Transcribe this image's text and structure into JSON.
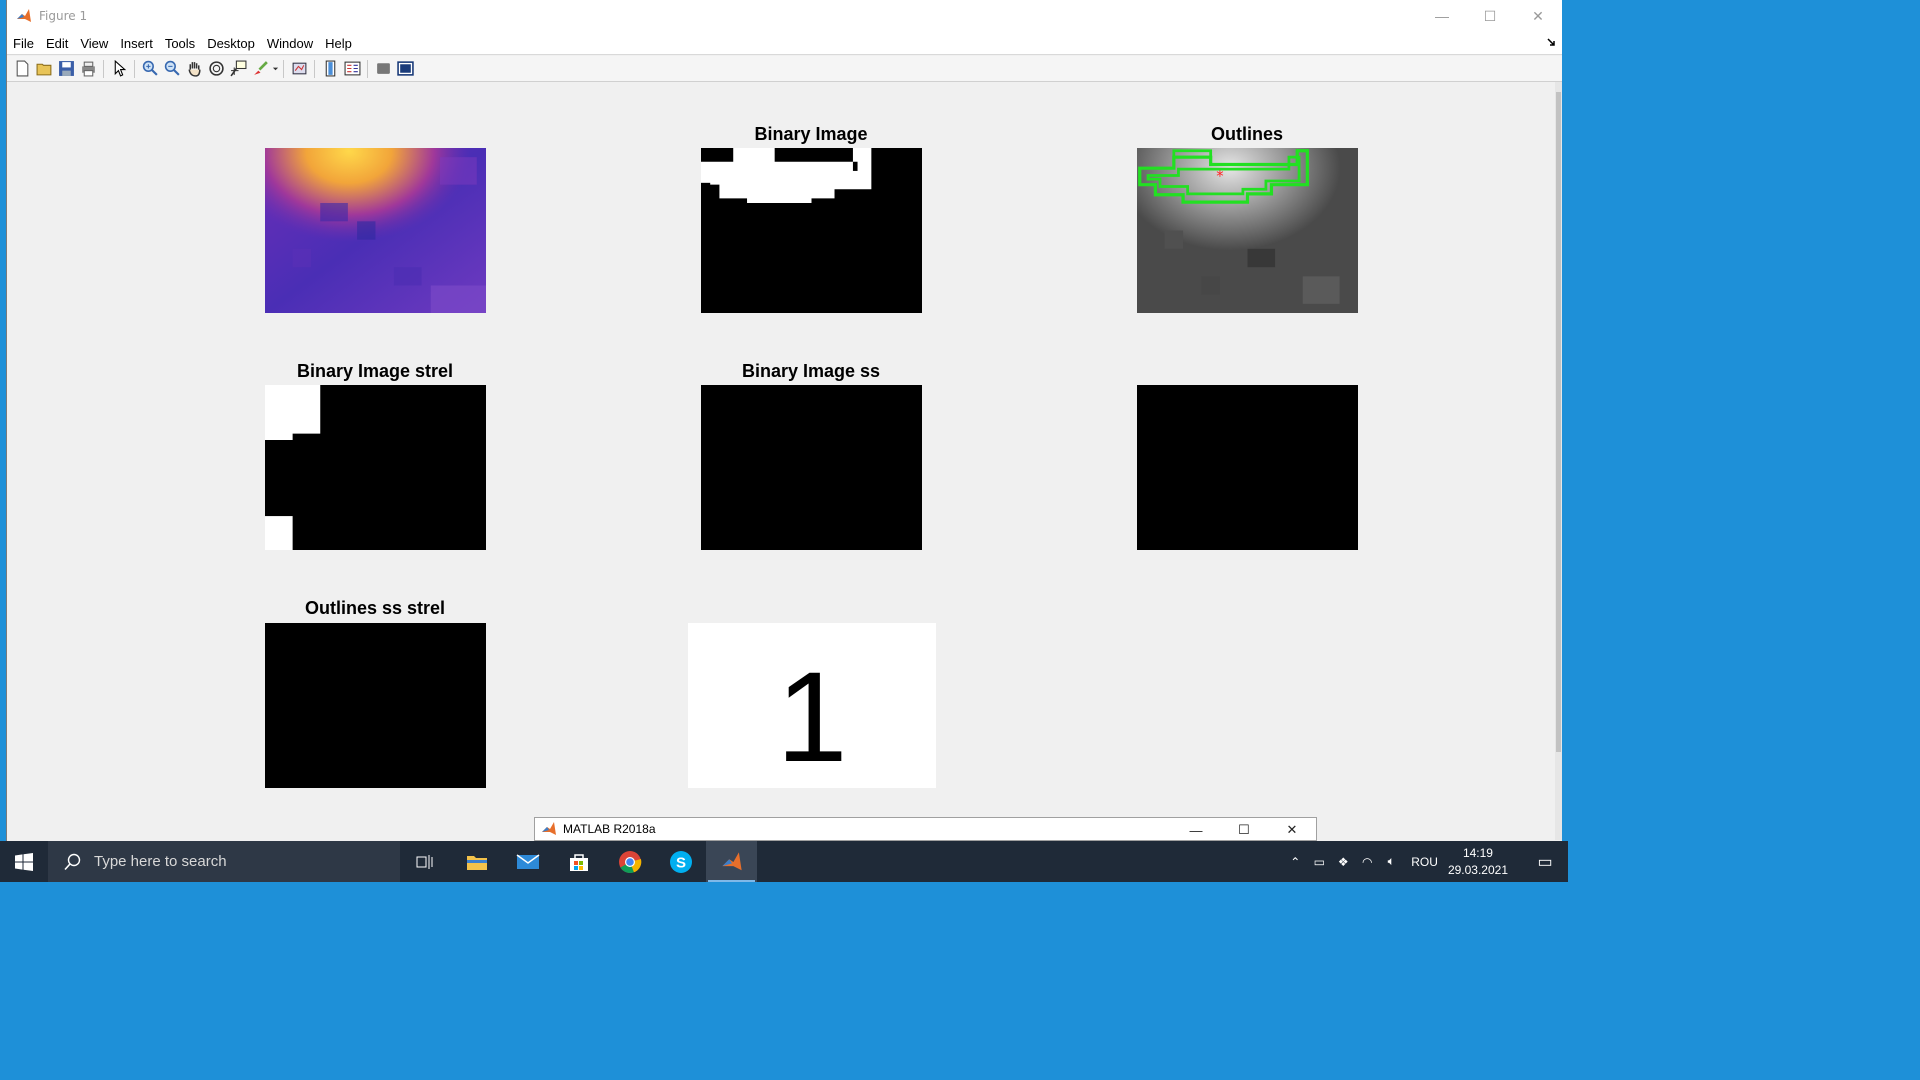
{
  "window": {
    "title": "Figure 1",
    "controls": {
      "minimize": "—",
      "maximize": "☐",
      "close": "✕"
    }
  },
  "menu": {
    "items": [
      "File",
      "Edit",
      "View",
      "Insert",
      "Tools",
      "Desktop",
      "Window",
      "Help"
    ]
  },
  "toolbar": {
    "buttons": [
      "new-figure",
      "open-file",
      "save-figure",
      "print-figure",
      "edit-plot",
      "zoom-in",
      "zoom-out",
      "pan",
      "rotate-3d",
      "data-cursor",
      "brush",
      "link-plot",
      "insert-colorbar",
      "insert-legend",
      "hide-plot-tools",
      "show-plot-tools"
    ]
  },
  "subplots": [
    {
      "title": "",
      "content": "thermal-image"
    },
    {
      "title": "Binary Image",
      "content": "binary-image"
    },
    {
      "title": "Outlines",
      "content": "outline-image"
    },
    {
      "title": "Binary Image strel",
      "content": "binary-strel"
    },
    {
      "title": "Binary Image ss",
      "content": "black-image"
    },
    {
      "title": "",
      "content": "black-image"
    },
    {
      "title": "Outlines ss strel",
      "content": "black-image"
    },
    {
      "title": "",
      "content": "count-text",
      "value": "1"
    }
  ],
  "preview": {
    "title": "MATLAB R2018a"
  },
  "taskbar": {
    "search_placeholder": "Type here to search",
    "language": "ROU",
    "time": "14:19",
    "date": "29.03.2021"
  }
}
